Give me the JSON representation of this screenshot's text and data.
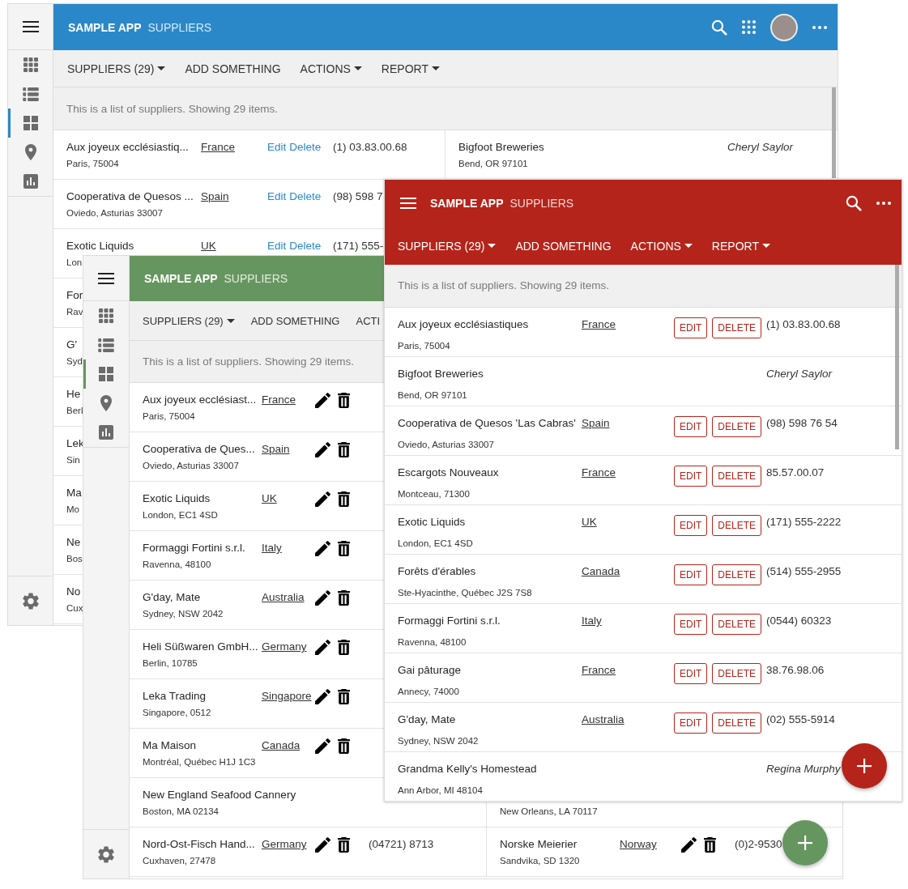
{
  "windows": [
    {
      "kind": "desktop",
      "color": "#2b88c8",
      "app_name": "SAMPLE APP",
      "page_title": "SUPPLIERS",
      "sidebar": {
        "items": [
          {
            "selected": false
          },
          {
            "selected": false
          },
          {
            "selected": true
          },
          {
            "selected": false
          },
          {
            "selected": false
          }
        ]
      },
      "toolbar": [
        {
          "label": "SUPPLIERS (29)",
          "dropdown": true
        },
        {
          "label": "ADD SOMETHING",
          "dropdown": false
        },
        {
          "label": "ACTIONS",
          "dropdown": true
        },
        {
          "label": "REPORT",
          "dropdown": true
        }
      ],
      "info": "This is a list of suppliers. Showing 29 items.",
      "rows": [
        {
          "cells": [
            {
              "name": "Aux joyeux ecclésiastiq...",
              "address": "Paris, 75004",
              "country": "France",
              "actions": [
                {
                  "kind": "edit",
                  "label": "Edit"
                },
                {
                  "kind": "delete",
                  "label": "Delete"
                }
              ],
              "phone": "(1) 03.83.00.68"
            },
            {
              "name": "Bigfoot Breweries",
              "address": "Bend, OR 97101",
              "contact": "Cheryl Saylor"
            }
          ]
        },
        {
          "cells": [
            {
              "name": "Cooperativa de Quesos ...",
              "address": "Oviedo, Asturias 33007",
              "country": "Spain",
              "actions": [
                {
                  "kind": "edit",
                  "label": "Edit"
                },
                {
                  "kind": "delete",
                  "label": "Delete"
                }
              ],
              "phone": "(98) 598 7"
            }
          ]
        },
        {
          "cells": [
            {
              "name": "Exotic Liquids",
              "address": "Lon",
              "country": "UK",
              "actions": [
                {
                  "kind": "edit",
                  "label": "Edit"
                },
                {
                  "kind": "delete",
                  "label": "Delete"
                }
              ],
              "phone": "(171) 555-"
            }
          ]
        },
        {
          "cells": [
            {
              "name": "For",
              "address": "Rav"
            }
          ]
        },
        {
          "cells": [
            {
              "name": "G'",
              "address": "Syd"
            }
          ]
        },
        {
          "cells": [
            {
              "name": "He",
              "address": "Berl"
            }
          ]
        },
        {
          "cells": [
            {
              "name": "Lek",
              "address": "Sin"
            }
          ]
        },
        {
          "cells": [
            {
              "name": "Ma",
              "address": "Mo"
            }
          ]
        },
        {
          "cells": [
            {
              "name": "Ne",
              "address": "Bos"
            }
          ]
        },
        {
          "cells": [
            {
              "name": "No",
              "address": "Cux"
            }
          ]
        }
      ]
    },
    {
      "kind": "tablet",
      "color": "#66965f",
      "app_name": "SAMPLE APP",
      "page_title": "SUPPLIERS",
      "sidebar": {
        "items": [
          {
            "selected": false
          },
          {
            "selected": false
          },
          {
            "selected": true
          },
          {
            "selected": false
          },
          {
            "selected": false
          }
        ]
      },
      "toolbar": [
        {
          "label": "SUPPLIERS (29)",
          "dropdown": true
        },
        {
          "label": "ADD SOMETHING",
          "dropdown": false
        },
        {
          "label": "ACTI",
          "dropdown": false
        }
      ],
      "info": "This is a list of suppliers. Showing 29 items.",
      "rows": [
        {
          "cells": [
            {
              "name": "Aux joyeux ecclésiast...",
              "address": "Paris, 75004",
              "country": "France",
              "actions": [
                {
                  "kind": "edit"
                },
                {
                  "kind": "delete"
                }
              ]
            }
          ]
        },
        {
          "cells": [
            {
              "name": "Cooperativa de Ques...",
              "address": "Oviedo, Asturias 33007",
              "country": "Spain",
              "actions": [
                {
                  "kind": "edit"
                },
                {
                  "kind": "delete"
                }
              ]
            }
          ]
        },
        {
          "cells": [
            {
              "name": "Exotic Liquids",
              "address": "London, EC1 4SD",
              "country": "UK",
              "actions": [
                {
                  "kind": "edit"
                },
                {
                  "kind": "delete"
                }
              ]
            }
          ]
        },
        {
          "cells": [
            {
              "name": "Formaggi Fortini s.r.l.",
              "address": "Ravenna, 48100",
              "country": "Italy",
              "actions": [
                {
                  "kind": "edit"
                },
                {
                  "kind": "delete"
                }
              ]
            }
          ]
        },
        {
          "cells": [
            {
              "name": "G'day, Mate",
              "address": "Sydney, NSW 2042",
              "country": "Australia",
              "actions": [
                {
                  "kind": "edit"
                },
                {
                  "kind": "delete"
                }
              ]
            }
          ]
        },
        {
          "cells": [
            {
              "name": "Heli Süßwaren GmbH...",
              "address": "Berlin, 10785",
              "country": "Germany",
              "actions": [
                {
                  "kind": "edit"
                },
                {
                  "kind": "delete"
                }
              ]
            }
          ]
        },
        {
          "cells": [
            {
              "name": "Leka Trading",
              "address": "Singapore, 0512",
              "country": "Singapore",
              "actions": [
                {
                  "kind": "edit"
                },
                {
                  "kind": "delete"
                }
              ]
            }
          ]
        },
        {
          "cells": [
            {
              "name": "Ma Maison",
              "address": "Montréal, Québec H1J 1C3",
              "country": "Canada",
              "actions": [
                {
                  "kind": "edit"
                },
                {
                  "kind": "delete"
                }
              ]
            }
          ]
        },
        {
          "cells": [
            {
              "name": "New England Seafood Cannery",
              "address": "Boston, MA 02134"
            },
            {
              "address": "New Orleans, LA 70117"
            }
          ]
        },
        {
          "cells": [
            {
              "name": "Nord-Ost-Fisch Hand...",
              "address": "Cuxhaven, 27478",
              "country": "Germany",
              "actions": [
                {
                  "kind": "edit"
                },
                {
                  "kind": "delete"
                }
              ],
              "phone": "(04721) 8713"
            },
            {
              "name": "Norske Meierier",
              "address": "Sandvika, SD 1320",
              "country": "Norway",
              "actions": [
                {
                  "kind": "edit"
                },
                {
                  "kind": "delete"
                }
              ],
              "phone": "(0)2-9530"
            }
          ]
        }
      ]
    },
    {
      "kind": "phone",
      "color": "#b5241a",
      "app_name": "SAMPLE APP",
      "page_title": "SUPPLIERS",
      "toolbar": [
        {
          "label": "SUPPLIERS (29)",
          "dropdown": true
        },
        {
          "label": "ADD SOMETHING",
          "dropdown": false
        },
        {
          "label": "ACTIONS",
          "dropdown": true
        },
        {
          "label": "REPORT",
          "dropdown": true
        }
      ],
      "info": "This is a list of suppliers. Showing 29 items.",
      "rows": [
        {
          "cells": [
            {
              "name": "Aux joyeux ecclésiastiques",
              "address": "Paris, 75004",
              "country": "France",
              "actions": [
                {
                  "kind": "edit",
                  "label": "EDIT"
                },
                {
                  "kind": "delete",
                  "label": "DELETE"
                }
              ],
              "phone": "(1) 03.83.00.68"
            }
          ]
        },
        {
          "cells": [
            {
              "name": "Bigfoot Breweries",
              "address": "Bend, OR 97101",
              "contact": "Cheryl Saylor"
            }
          ]
        },
        {
          "cells": [
            {
              "name": "Cooperativa de Quesos 'Las Cabras'",
              "address": "Oviedo, Asturias 33007",
              "country": "Spain",
              "actions": [
                {
                  "kind": "edit",
                  "label": "EDIT"
                },
                {
                  "kind": "delete",
                  "label": "DELETE"
                }
              ],
              "phone": "(98) 598 76 54"
            }
          ]
        },
        {
          "cells": [
            {
              "name": "Escargots Nouveaux",
              "address": "Montceau, 71300",
              "country": "France",
              "actions": [
                {
                  "kind": "edit",
                  "label": "EDIT"
                },
                {
                  "kind": "delete",
                  "label": "DELETE"
                }
              ],
              "phone": "85.57.00.07"
            }
          ]
        },
        {
          "cells": [
            {
              "name": "Exotic Liquids",
              "address": "London, EC1 4SD",
              "country": "UK",
              "actions": [
                {
                  "kind": "edit",
                  "label": "EDIT"
                },
                {
                  "kind": "delete",
                  "label": "DELETE"
                }
              ],
              "phone": "(171) 555-2222"
            }
          ]
        },
        {
          "cells": [
            {
              "name": "Forêts d'érables",
              "address": "Ste-Hyacinthe, Québec J2S 7S8",
              "country": "Canada",
              "actions": [
                {
                  "kind": "edit",
                  "label": "EDIT"
                },
                {
                  "kind": "delete",
                  "label": "DELETE"
                }
              ],
              "phone": "(514) 555-2955"
            }
          ]
        },
        {
          "cells": [
            {
              "name": "Formaggi Fortini s.r.l.",
              "address": "Ravenna, 48100",
              "country": "Italy",
              "actions": [
                {
                  "kind": "edit",
                  "label": "EDIT"
                },
                {
                  "kind": "delete",
                  "label": "DELETE"
                }
              ],
              "phone": "(0544) 60323"
            }
          ]
        },
        {
          "cells": [
            {
              "name": "Gai pâturage",
              "address": "Annecy, 74000",
              "country": "France",
              "actions": [
                {
                  "kind": "edit",
                  "label": "EDIT"
                },
                {
                  "kind": "delete",
                  "label": "DELETE"
                }
              ],
              "phone": "38.76.98.06"
            }
          ]
        },
        {
          "cells": [
            {
              "name": "G'day, Mate",
              "address": "Sydney, NSW 2042",
              "country": "Australia",
              "actions": [
                {
                  "kind": "edit",
                  "label": "EDIT"
                },
                {
                  "kind": "delete",
                  "label": "DELETE"
                }
              ],
              "phone": "(02) 555-5914"
            }
          ]
        },
        {
          "cells": [
            {
              "name": "Grandma Kelly's Homestead",
              "address": "Ann Arbor, MI 48104",
              "contact": "Regina Murphy"
            }
          ]
        }
      ]
    }
  ]
}
